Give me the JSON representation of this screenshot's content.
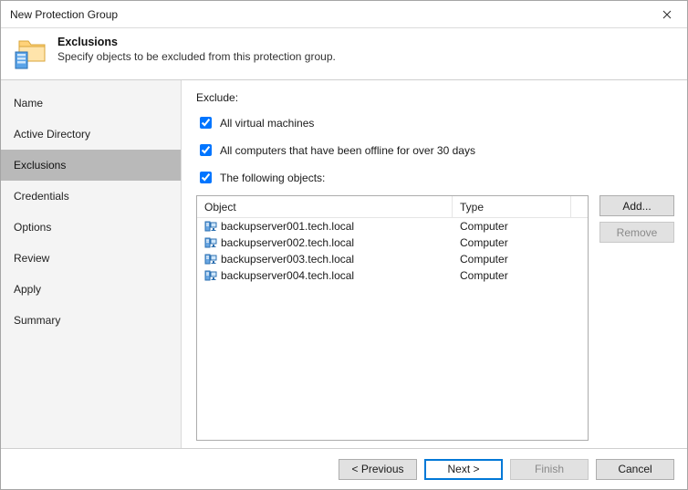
{
  "window": {
    "title": "New Protection Group"
  },
  "header": {
    "title": "Exclusions",
    "subtitle": "Specify objects to be excluded from this protection group."
  },
  "sidebar": {
    "items": [
      {
        "label": "Name"
      },
      {
        "label": "Active Directory"
      },
      {
        "label": "Exclusions"
      },
      {
        "label": "Credentials"
      },
      {
        "label": "Options"
      },
      {
        "label": "Review"
      },
      {
        "label": "Apply"
      },
      {
        "label": "Summary"
      }
    ],
    "active_index": 2
  },
  "main": {
    "exclude_label": "Exclude:",
    "chk_vm": "All virtual machines",
    "chk_offline": "All computers that have been offline for over 30 days",
    "chk_objects": "The following objects:"
  },
  "grid": {
    "headers": {
      "object": "Object",
      "type": "Type"
    },
    "rows": [
      {
        "object": "backupserver001.tech.local",
        "type": "Computer"
      },
      {
        "object": "backupserver002.tech.local",
        "type": "Computer"
      },
      {
        "object": "backupserver003.tech.local",
        "type": "Computer"
      },
      {
        "object": "backupserver004.tech.local",
        "type": "Computer"
      }
    ]
  },
  "buttons": {
    "add": "Add...",
    "remove": "Remove",
    "previous": "< Previous",
    "next": "Next >",
    "finish": "Finish",
    "cancel": "Cancel"
  }
}
